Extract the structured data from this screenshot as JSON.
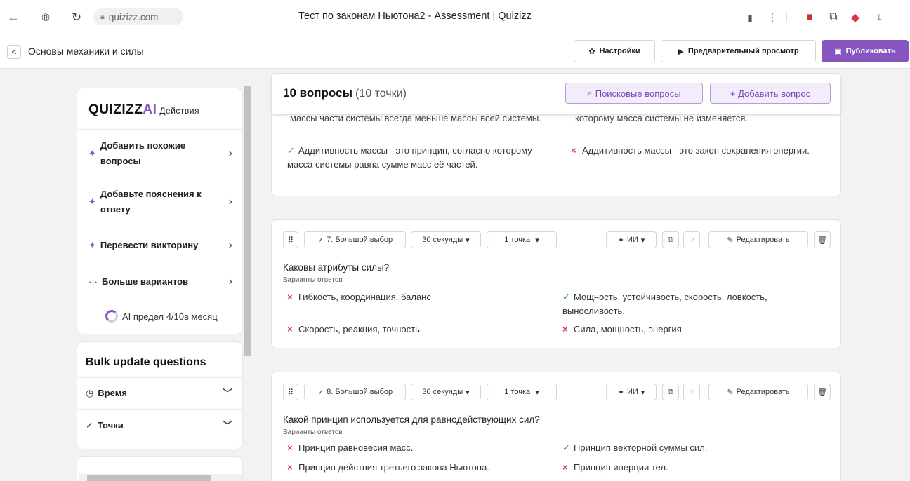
{
  "browser": {
    "url": "quizizz.com",
    "title": "Тест по законам Ньютона2 - Assessment | Quizizz"
  },
  "header": {
    "title": "Основы механики и силы",
    "settings": "Настройки",
    "preview": "Предварительный просмотр",
    "publish": "Публиковать"
  },
  "sidebar": {
    "logo_text": "QUIZIZZ",
    "logo_ai": "AI",
    "logo_actions": "Действия",
    "actions": [
      {
        "label": "Добавить похожие вопросы"
      },
      {
        "label": "Добавьте пояснения к ответу"
      },
      {
        "label": "Перевести викторину"
      },
      {
        "label": "Больше вариантов"
      }
    ],
    "ai_limit": "AI предел 4/10в месяц",
    "bulk_title": "Bulk update questions",
    "bulk_time": "Время",
    "bulk_points": "Точки"
  },
  "questions_header": {
    "count": "10 вопросы",
    "points": "(10 точки)",
    "search": "Поисковые вопросы",
    "add": "+ Добавить вопрос"
  },
  "partial_card": {
    "top_left": "массы части системы всегда меньше массы всей системы.",
    "top_right": "которому масса системы не изменяется.",
    "a1": "Аддитивность массы - это принцип, согласно которому масса системы равна сумме масс её частей.",
    "a2": "Аддитивность массы - это закон сохранения энергии."
  },
  "toolbar": {
    "time": "30 секунды",
    "points": "1 точка",
    "ai": "ИИ",
    "edit": "Редактировать"
  },
  "q7": {
    "type": "7. Большой выбор",
    "question": "Каковы атрибуты силы?",
    "answers_label": "Варианты ответов",
    "answers": [
      {
        "text": "Гибкость, координация, баланс",
        "correct": false
      },
      {
        "text": "Мощность, устойчивость, скорость, ловкость, выносливость.",
        "correct": true
      },
      {
        "text": "Скорость, реакция, точность",
        "correct": false
      },
      {
        "text": "Сила, мощность, энергия",
        "correct": false
      }
    ]
  },
  "q8": {
    "type": "8. Большой выбор",
    "question": "Какой принцип используется для равнодействующих сил?",
    "answers_label": "Варианты ответов",
    "answers": [
      {
        "text": "Принцип равновесия масс.",
        "correct": false
      },
      {
        "text": "Принцип векторной суммы сил.",
        "correct": true
      },
      {
        "text": "Принцип действия третьего закона Ньютона.",
        "correct": false
      },
      {
        "text": "Принцип инерции тел.",
        "correct": false
      }
    ]
  },
  "colors": {
    "accent": "#8854c0",
    "correct": "#2a9d57",
    "wrong": "#d9364a"
  }
}
